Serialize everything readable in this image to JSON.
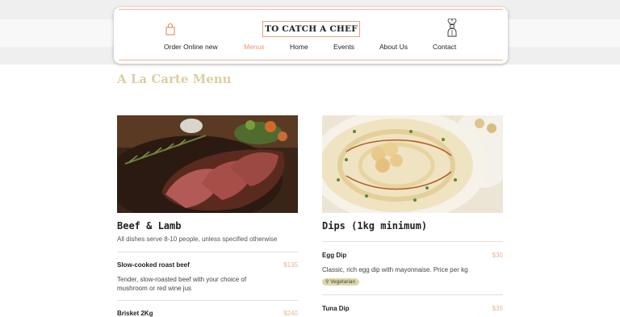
{
  "brand": {
    "logo_text": "TO CATCH A CHEF"
  },
  "nav": {
    "items": [
      {
        "label": "Order Online new",
        "active": false
      },
      {
        "label": "Menus",
        "active": true
      },
      {
        "label": "Home",
        "active": false
      },
      {
        "label": "Events",
        "active": false
      },
      {
        "label": "About Us",
        "active": false
      },
      {
        "label": "Contact",
        "active": false
      }
    ]
  },
  "icons": {
    "cart": "shopping-bag-icon",
    "chef": "chef-mascot-icon"
  },
  "colors": {
    "accent": "#e8946e",
    "title_gold": "#dccf9e",
    "tag_bg": "#ddd6a9",
    "price": "#e8b49c"
  },
  "page": {
    "section_title": "A La Carte Menu"
  },
  "categories": [
    {
      "title": "Beef & Lamb",
      "subtitle": "All dishes serve 8-10 people, unless specified otherwise",
      "items": [
        {
          "name": "Slow-cooked roast beef",
          "price": "$135",
          "description_line1": "Tender, slow-roasted beef with your choice of",
          "description_line2": "mushroom or red wine jus"
        },
        {
          "name": "Brisket 2Kg",
          "price": "$240"
        }
      ]
    },
    {
      "title": "Dips (1kg minimum)",
      "items": [
        {
          "name": "Egg Dip",
          "price": "$30",
          "description": "Classic, rich egg dip with mayonnaise. Price per kg",
          "tag": "Vegetarian"
        },
        {
          "name": "Tuna Dip",
          "price": "$35"
        }
      ]
    }
  ]
}
